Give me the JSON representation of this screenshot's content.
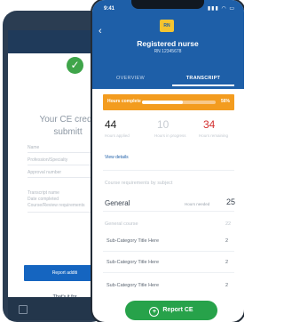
{
  "back_phone": {
    "title_line1": "Your CE credit",
    "title_line2": "submitt",
    "fields": [
      "Name",
      "Profession/Specialty",
      "Approval number",
      "Transcript name"
    ],
    "field_notes": [
      "Date completed",
      "Course/Review requirements"
    ],
    "report_button": "Report additi",
    "link_text": "That's it for"
  },
  "hero": {
    "status_time": "9:41",
    "status_icons": "▮▮▮ ◠ ▭",
    "back_arrow": "‹",
    "logo": "RN",
    "title": "Registered nurse",
    "subtitle": "RN 12345678",
    "tabs": [
      "OVERVIEW",
      "TRANSCRIPT"
    ]
  },
  "progress": {
    "label": "Hours complete",
    "percent_text": "56%",
    "fraction": 0.56
  },
  "stats": [
    {
      "value": "44",
      "label": "Hours applied",
      "color": "#222222"
    },
    {
      "value": "10",
      "label": "Hours in progress",
      "color": "#c7ccd2"
    },
    {
      "value": "34",
      "label": "Hours remaining",
      "color": "#d32f2f"
    }
  ],
  "view_details": "View details",
  "section_heading": "Course requirements by subject",
  "general": {
    "label": "General",
    "mini": "Hours needed",
    "value": "25"
  },
  "sub_row": {
    "label": "General course",
    "value": "22"
  },
  "courses": [
    {
      "label": "Sub-Category Title Here",
      "value": "2"
    },
    {
      "label": "Sub-Category Title Here",
      "value": "2"
    },
    {
      "label": "Sub-Category Title Here",
      "value": "2"
    }
  ],
  "report_button": "Report CE",
  "colors": {
    "brand_blue": "#1e5fa8",
    "progress_orange": "#f39c1f",
    "success_green": "#27a24a",
    "remaining_red": "#d32f2f"
  }
}
